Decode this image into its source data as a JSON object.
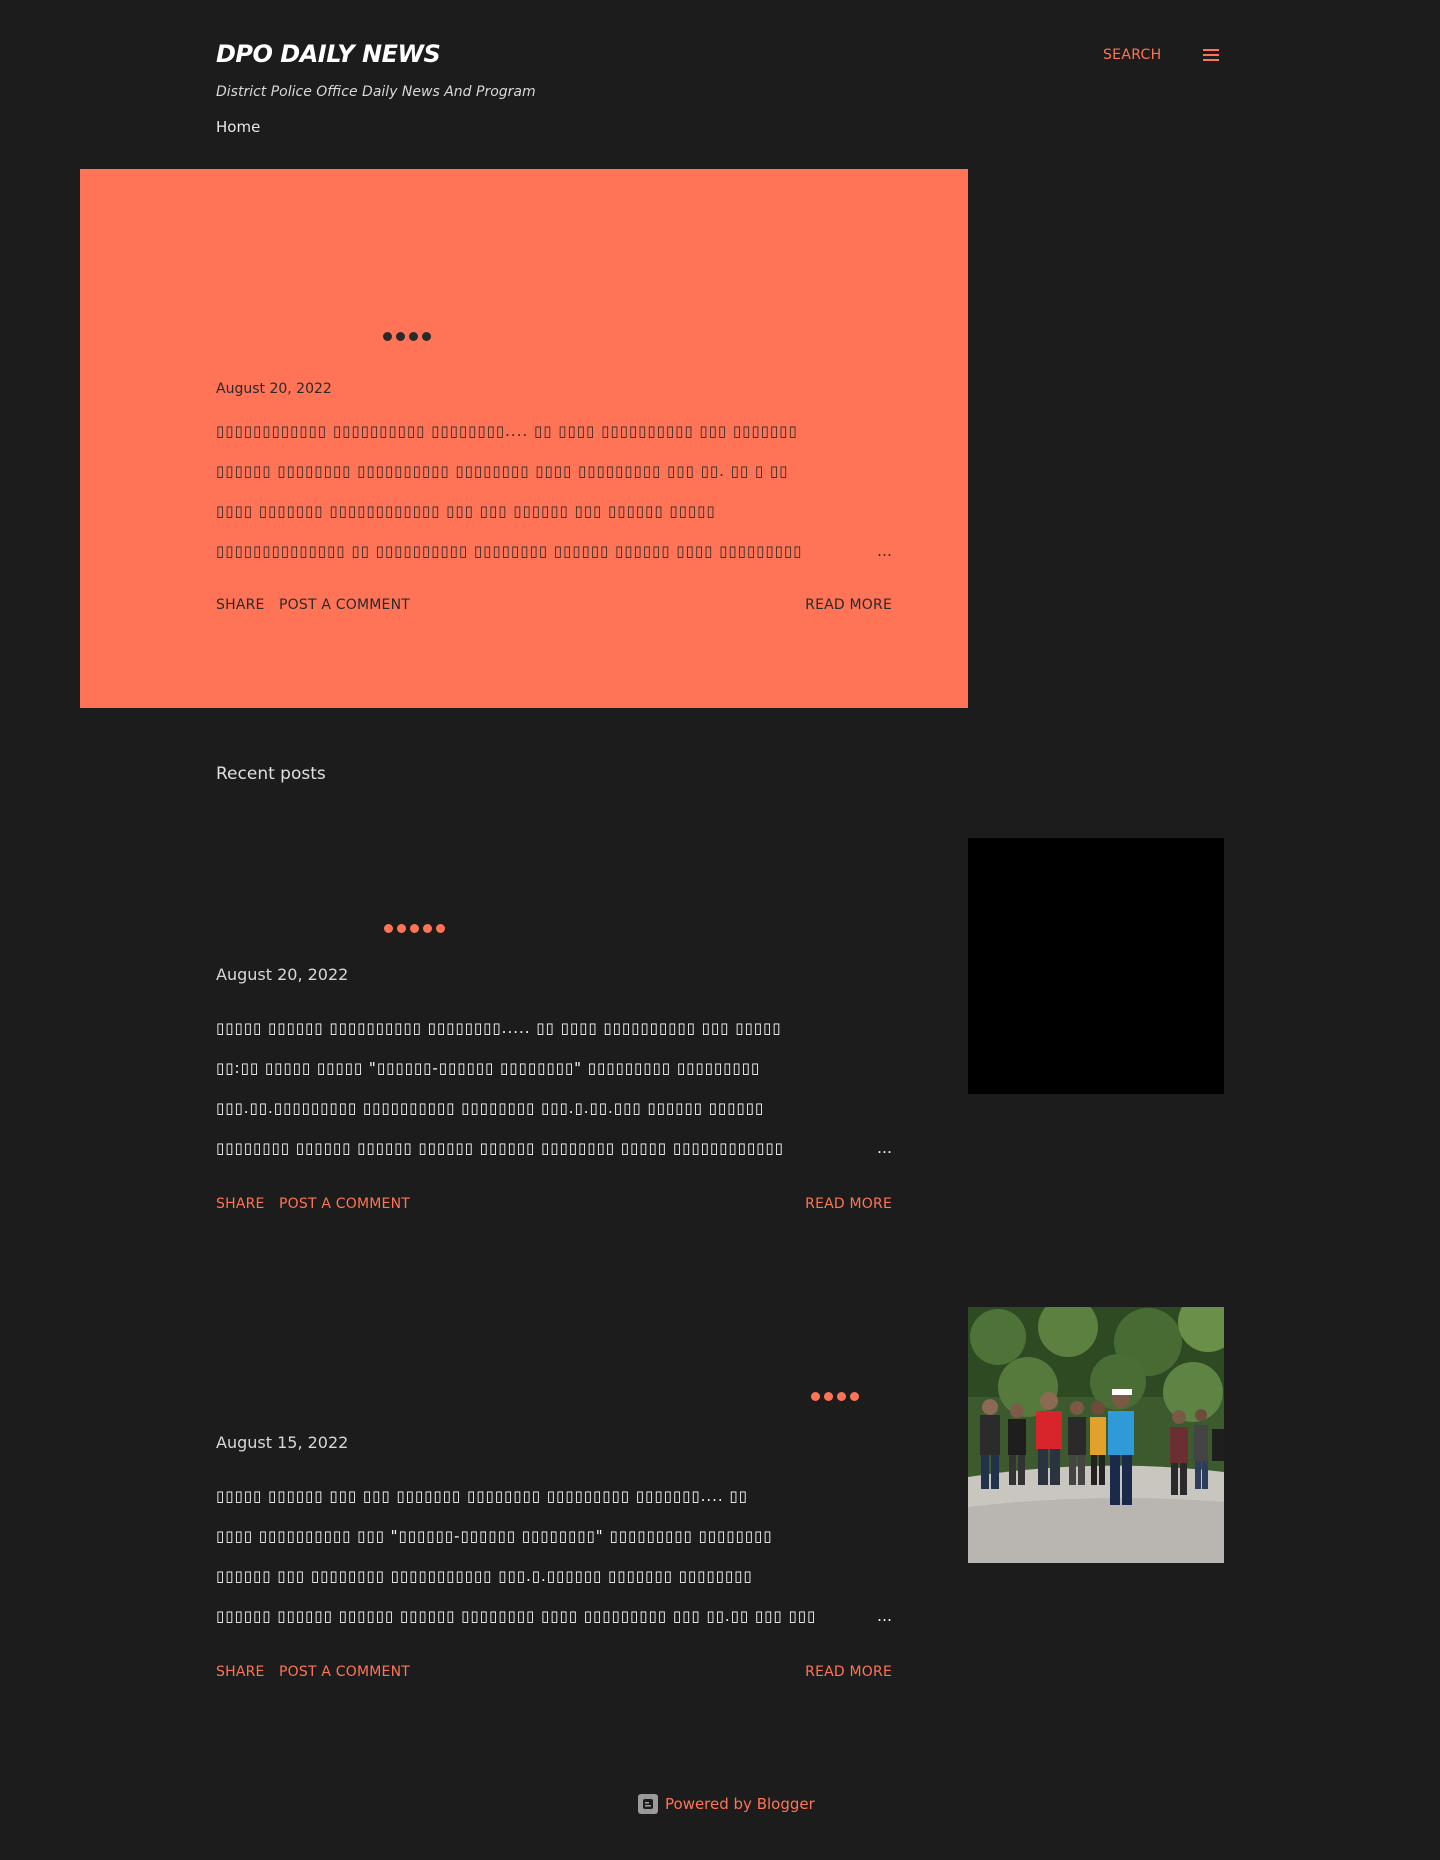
{
  "header": {
    "title": "DPO DAILY NEWS",
    "description": "District Police Office Daily News And Program",
    "search_label": "SEARCH",
    "menu_icon": "hamburger-menu-icon",
    "nav": [
      {
        "label": "Home"
      }
    ]
  },
  "colors": {
    "background": "#1c1c1c",
    "accent": "#ff7456",
    "dark_text": "#2a2a2a"
  },
  "featured_post": {
    "date": "August 20, 2022",
    "snippet_lines": [
      "  ▯▯▯▯▯▯▯▯▯▯▯▯ ▯▯▯▯▯▯▯▯▯▯ ▯▯▯▯▯▯▯▯.... ▯▯ ▯▯▯▯ ▯▯▯▯▯▯▯▯▯▯ ▯▯▯ ▯▯▯▯▯▯▯",
      "▯▯▯▯▯▯ ▯▯▯▯▯▯▯▯ ▯▯▯▯▯▯▯▯▯▯ ▯▯▯▯▯▯▯▯ ▯▯▯▯ ▯▯▯▯▯▯▯▯▯ ▯▯▯ ▯▯. ▯▯ ▯ ▯▯",
      "▯▯▯▯ ▯▯▯▯▯▯▯ ▯▯▯▯▯▯▯▯▯▯▯▯ ▯▯▯ ▯▯▯ ▯▯▯▯▯▯ ▯▯▯ ▯▯▯▯▯▯ ▯▯▯▯▯",
      "▯▯▯▯▯▯▯▯▯▯▯▯▯▯ ▯▯ ▯▯▯▯▯▯▯▯▯▯ ▯▯▯▯▯▯▯▯ ▯▯▯▯▯▯ ▯▯▯▯▯▯ ▯▯▯▯ ▯▯▯▯▯▯▯▯▯"
    ],
    "ellipsis": "…",
    "share_label": "SHARE",
    "comment_label": "POST A COMMENT",
    "read_more_label": "READ MORE"
  },
  "recent_heading": "Recent posts",
  "recent_posts": [
    {
      "date": "August 20, 2022",
      "snippet_lines": [
        "  ▯▯▯▯▯ ▯▯▯▯▯▯ ▯▯▯▯▯▯▯▯▯▯ ▯▯▯▯▯▯▯▯..... ▯▯ ▯▯▯▯ ▯▯▯▯▯▯▯▯▯▯ ▯▯▯ ▯▯▯▯▯",
        "▯▯:▯▯ ▯▯▯▯▯ ▯▯▯▯▯ \"▯▯▯▯▯▯-▯▯▯▯▯▯ ▯▯▯▯▯▯▯▯\" ▯▯▯▯▯▯▯▯▯ ▯▯▯▯▯▯▯▯▯",
        "▯▯▯.▯▯.▯▯▯▯▯▯▯▯▯ ▯▯▯▯▯▯▯▯▯▯ ▯▯▯▯▯▯▯▯ ▯▯▯.▯.▯▯.▯▯▯ ▯▯▯▯▯▯ ▯▯▯▯▯▯",
        "▯▯▯▯▯▯▯▯ ▯▯▯▯▯▯ ▯▯▯▯▯▯ ▯▯▯▯▯▯ ▯▯▯▯▯▯ ▯▯▯▯▯▯▯▯ ▯▯▯▯▯ ▯▯▯▯▯▯▯▯▯▯▯▯"
      ],
      "ellipsis": "…",
      "share_label": "SHARE",
      "comment_label": "POST A COMMENT",
      "read_more_label": "READ MORE",
      "thumbnail": "black-video-thumbnail"
    },
    {
      "date": "August 15, 2022",
      "snippet_lines": [
        "  ▯▯▯▯▯ ▯▯▯▯▯▯ ▯▯▯ ▯▯▯ ▯▯▯▯▯▯▯ ▯▯▯▯▯▯▯▯ ▯▯▯▯▯▯▯▯▯ ▯▯▯▯▯▯▯....         ▯▯",
        "▯▯▯▯ ▯▯▯▯▯▯▯▯▯▯ ▯▯▯ \"▯▯▯▯▯▯-▯▯▯▯▯▯ ▯▯▯▯▯▯▯▯\" ▯▯▯▯▯▯▯▯▯ ▯▯▯▯▯▯▯▯",
        "▯▯▯▯▯▯ ▯▯▯ ▯▯▯▯▯▯▯▯ ▯▯▯▯▯▯▯▯▯▯▯ ▯▯▯.▯.▯▯▯▯▯▯ ▯▯▯▯▯▯▯ ▯▯▯▯▯▯▯▯",
        "▯▯▯▯▯▯ ▯▯▯▯▯▯ ▯▯▯▯▯▯ ▯▯▯▯▯▯ ▯▯▯▯▯▯▯▯ ▯▯▯▯ ▯▯▯▯▯▯▯▯▯ ▯▯▯ ▯▯.▯▯ ▯▯▯ ▯▯▯"
      ],
      "ellipsis": "…",
      "share_label": "SHARE",
      "comment_label": "POST A COMMENT",
      "read_more_label": "READ MORE",
      "thumbnail": "traffic-police-photo"
    }
  ],
  "footer": {
    "label": "Powered by Blogger",
    "icon": "blogger-icon"
  }
}
